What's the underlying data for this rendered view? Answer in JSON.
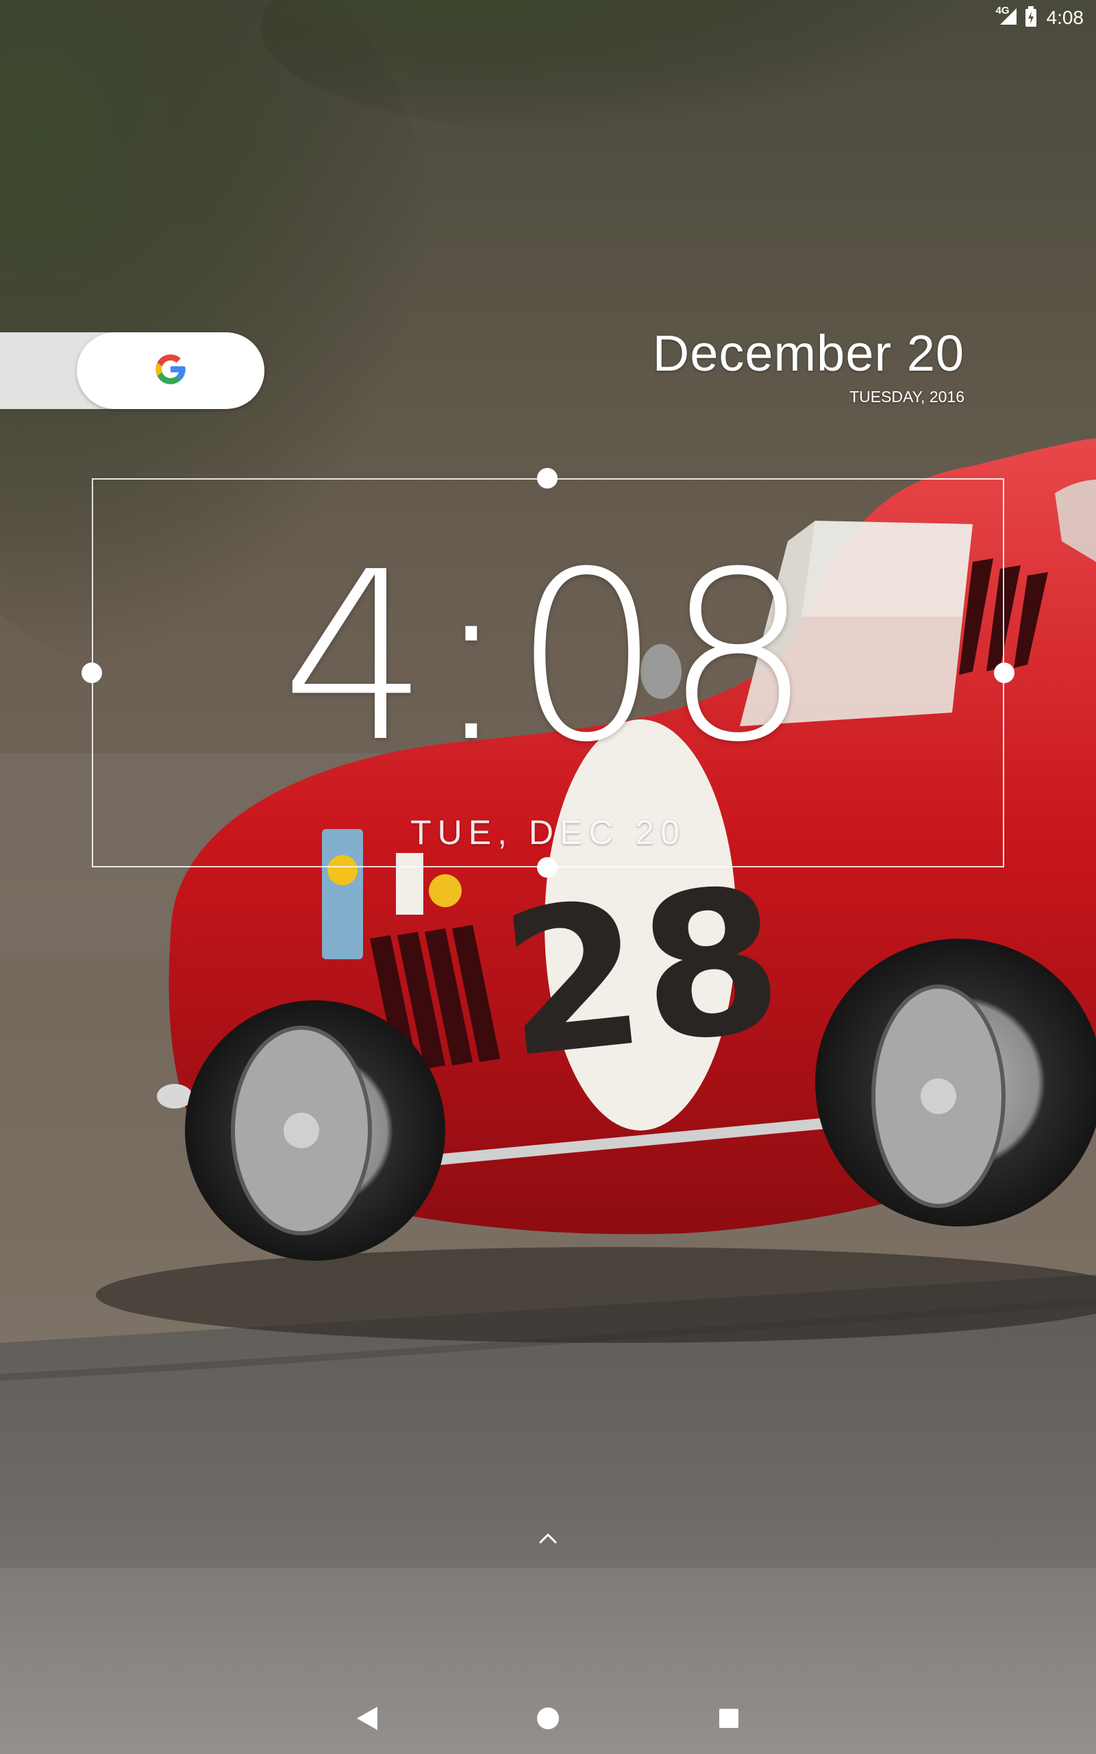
{
  "status_bar": {
    "network": "4G",
    "time": "4:08"
  },
  "search": {
    "icon": "google-g-icon"
  },
  "date_widget": {
    "date": "December 20",
    "day_year": "TUESDAY, 2016"
  },
  "clock_widget": {
    "time": "4:08",
    "date": "TUE, DEC 20"
  },
  "nav": {
    "back_icon": "back-triangle-icon",
    "home_icon": "home-circle-icon",
    "recents_icon": "recents-square-icon"
  },
  "colors": {
    "car_red": "#c8161c",
    "google_blue": "#4285F4",
    "google_red": "#EA4335",
    "google_yellow": "#FBBC05",
    "google_green": "#34A853"
  }
}
